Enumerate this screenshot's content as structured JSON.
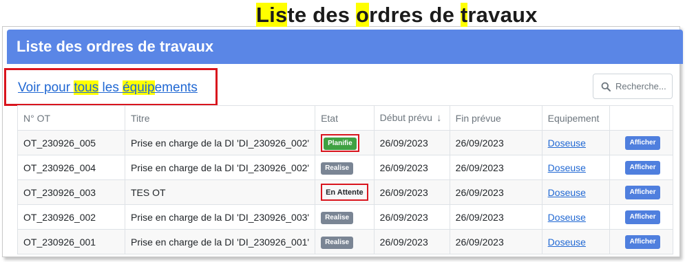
{
  "page_title": {
    "segments": [
      {
        "text": "Lis",
        "highlight": true
      },
      {
        "text": "te des ",
        "highlight": false
      },
      {
        "text": "o",
        "highlight": true
      },
      {
        "text": "rdres de ",
        "highlight": false
      },
      {
        "text": "t",
        "highlight": true
      },
      {
        "text": "ravaux",
        "highlight": false
      }
    ]
  },
  "card": {
    "header_title": "Liste des ordres de travaux"
  },
  "equipment_link": {
    "segments": [
      {
        "text": "Voir pour ",
        "highlight": false
      },
      {
        "text": "tous",
        "highlight": true
      },
      {
        "text": " les ",
        "highlight": false
      },
      {
        "text": "équip",
        "highlight": true
      },
      {
        "text": "ements",
        "highlight": false
      }
    ]
  },
  "search": {
    "placeholder": "Recherche..."
  },
  "table": {
    "headers": {
      "num": "N° OT",
      "titre": "Titre",
      "etat": "Etat",
      "debut": "Début prévu",
      "fin": "Fin prévue",
      "equipement": "Equipement",
      "action": ""
    },
    "sort_indicator": "↓",
    "rows": [
      {
        "num": "OT_230926_005",
        "titre": "Prise en charge de la DI 'DI_230926_002'",
        "etat": "Planifie",
        "etat_style": "green",
        "etat_highlighted": true,
        "debut": "26/09/2023",
        "fin": "26/09/2023",
        "equipement": "Doseuse",
        "action": "Afficher"
      },
      {
        "num": "OT_230926_004",
        "titre": "Prise en charge de la DI 'DI_230926_002'",
        "etat": "Realise",
        "etat_style": "gray",
        "etat_highlighted": false,
        "debut": "26/09/2023",
        "fin": "26/09/2023",
        "equipement": "Doseuse",
        "action": "Afficher"
      },
      {
        "num": "OT_230926_003",
        "titre": "TES OT",
        "etat": "En Attente",
        "etat_style": "plain",
        "etat_highlighted": true,
        "debut": "26/09/2023",
        "fin": "26/09/2023",
        "equipement": "Doseuse",
        "action": "Afficher"
      },
      {
        "num": "OT_230926_002",
        "titre": "Prise en charge de la DI 'DI_230926_003'",
        "etat": "Realise",
        "etat_style": "gray",
        "etat_highlighted": false,
        "debut": "26/09/2023",
        "fin": "26/09/2023",
        "equipement": "Doseuse",
        "action": "Afficher"
      },
      {
        "num": "OT_230926_001",
        "titre": "Prise en charge de la DI 'DI_230926_001'",
        "etat": "Realise",
        "etat_style": "gray",
        "etat_highlighted": false,
        "debut": "26/09/2023",
        "fin": "26/09/2023",
        "equipement": "Doseuse",
        "action": "Afficher"
      }
    ]
  },
  "colors": {
    "header_bg": "#5a86e6",
    "highlight": "#ffff00",
    "annotation_red": "#d9141d",
    "link": "#1f67d3",
    "badge_green": "#3fa142",
    "badge_gray": "#7a8594",
    "button_bg": "#4f7fde"
  },
  "icons": {
    "search": "search-icon",
    "sort": "sort-arrow-icon"
  }
}
